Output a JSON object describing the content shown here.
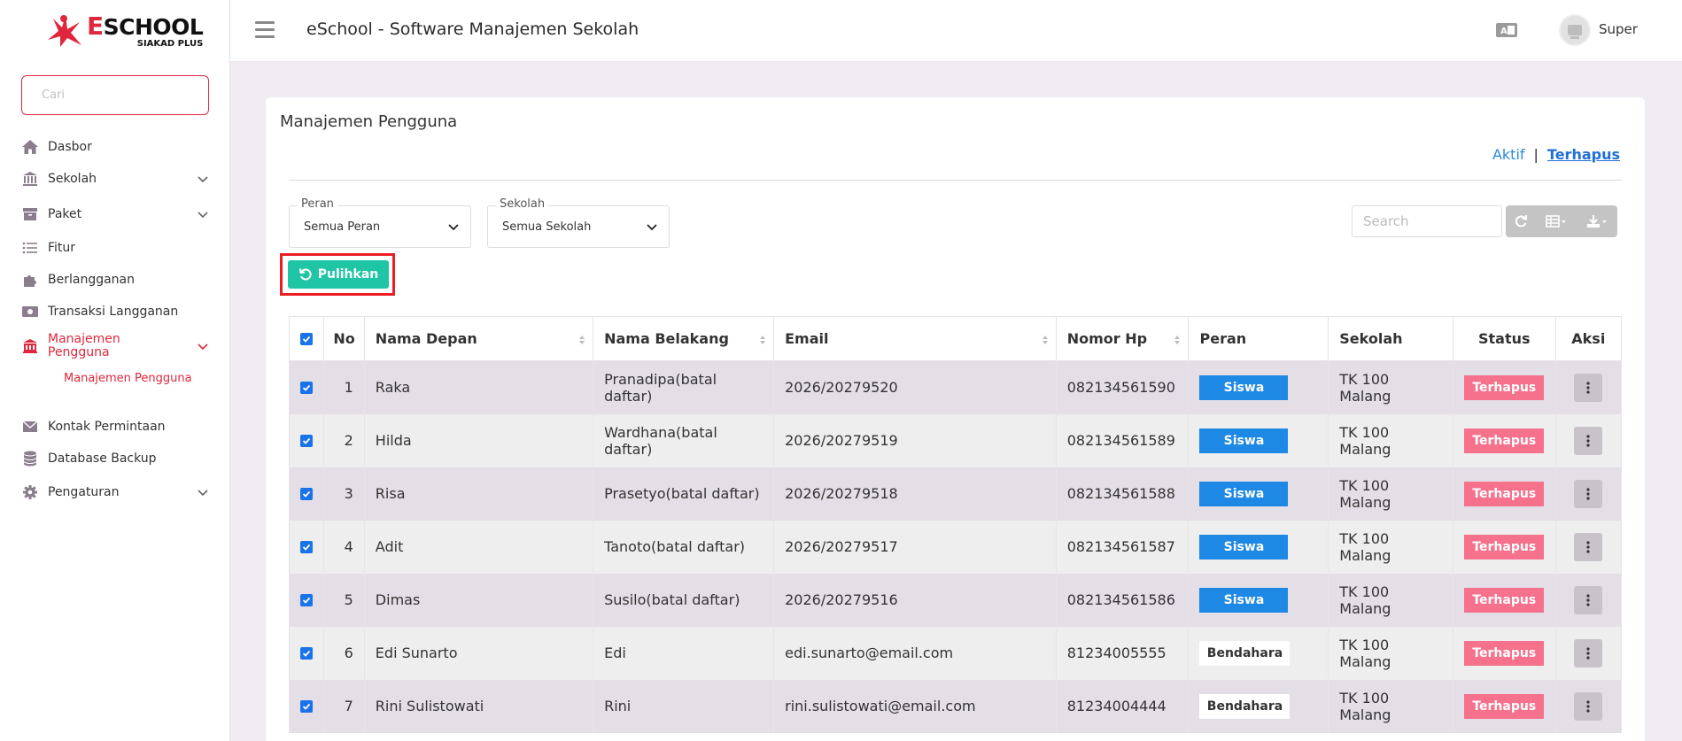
{
  "brand": {
    "name_first": "E",
    "name_rest": "SCHOOL",
    "sub": "SIAKAD PLUS"
  },
  "sidebar": {
    "search_placeholder": "Cari",
    "items": [
      {
        "label": "Dasbor",
        "icon": "home-icon"
      },
      {
        "label": "Sekolah",
        "icon": "bank-icon"
      },
      {
        "label": "Paket",
        "icon": "archive-icon"
      },
      {
        "label": "Fitur",
        "icon": "list-icon"
      },
      {
        "label": "Berlangganan",
        "icon": "puzzle-icon"
      },
      {
        "label": "Transaksi Langganan",
        "icon": "money-icon"
      },
      {
        "label_line1": "Manajemen",
        "label_line2": "Pengguna",
        "icon": "user-management-icon"
      },
      {
        "label": "Kontak Permintaan",
        "icon": "mail-icon"
      },
      {
        "label": "Database Backup",
        "icon": "database-icon"
      },
      {
        "label": "Pengaturan",
        "icon": "gear-icon"
      }
    ],
    "sub_item": "Manajemen Pengguna"
  },
  "topbar": {
    "title": "eSchool - Software Manajemen Sekolah",
    "user": "Super"
  },
  "page": {
    "title": "Manajemen Pengguna",
    "link_active": "Aktif",
    "link_separator": "|",
    "link_deleted": "Terhapus",
    "filter_role_label": "Peran",
    "filter_role_value": "Semua Peran",
    "filter_school_label": "Sekolah",
    "filter_school_value": "Semua Sekolah",
    "search_placeholder": "Search",
    "restore_label": "Pulihkan"
  },
  "table": {
    "headers": [
      "No",
      "Nama Depan",
      "Nama Belakang",
      "Email",
      "Nomor Hp",
      "Peran",
      "Sekolah",
      "Status",
      "Aksi"
    ],
    "rows": [
      {
        "no": "1",
        "first": "Raka",
        "last": "Pranadipa(batal daftar)",
        "email": "2026/20279520",
        "phone": "082134561590",
        "role": "Siswa",
        "school": "TK 100 Malang",
        "status": "Terhapus"
      },
      {
        "no": "2",
        "first": "Hilda",
        "last": "Wardhana(batal daftar)",
        "email": "2026/20279519",
        "phone": "082134561589",
        "role": "Siswa",
        "school": "TK 100 Malang",
        "status": "Terhapus"
      },
      {
        "no": "3",
        "first": "Risa",
        "last": "Prasetyo(batal daftar)",
        "email": "2026/20279518",
        "phone": "082134561588",
        "role": "Siswa",
        "school": "TK 100 Malang",
        "status": "Terhapus"
      },
      {
        "no": "4",
        "first": "Adit",
        "last": "Tanoto(batal daftar)",
        "email": "2026/20279517",
        "phone": "082134561587",
        "role": "Siswa",
        "school": "TK 100 Malang",
        "status": "Terhapus"
      },
      {
        "no": "5",
        "first": "Dimas",
        "last": "Susilo(batal daftar)",
        "email": "2026/20279516",
        "phone": "082134561586",
        "role": "Siswa",
        "school": "TK 100 Malang",
        "status": "Terhapus"
      },
      {
        "no": "6",
        "first": "Edi Sunarto",
        "last": "Edi",
        "email": "edi.sunarto@email.com",
        "phone": "81234005555",
        "role": "Bendahara",
        "school": "TK 100 Malang",
        "status": "Terhapus"
      },
      {
        "no": "7",
        "first": "Rini Sulistowati",
        "last": "Rini",
        "email": "rini.sulistowati@email.com",
        "phone": "81234004444",
        "role": "Bendahara",
        "school": "TK 100 Malang",
        "status": "Terhapus"
      }
    ]
  },
  "colors": {
    "accent": "#e0263c",
    "restore": "#1fc5a4",
    "role_siswa": "#1e88e5",
    "status_deleted": "#f5718c"
  }
}
